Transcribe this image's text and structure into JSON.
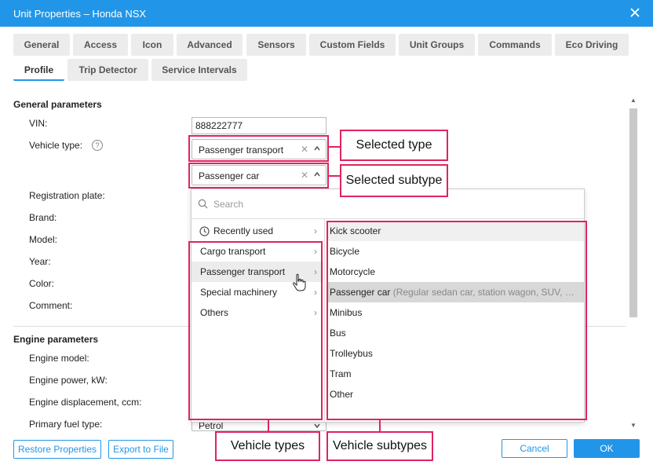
{
  "window": {
    "title": "Unit Properties – Honda NSX"
  },
  "tabs_row1": [
    "General",
    "Access",
    "Icon",
    "Advanced",
    "Sensors",
    "Custom Fields",
    "Unit Groups",
    "Commands",
    "Eco Driving"
  ],
  "tabs_row2": [
    "Profile",
    "Trip Detector",
    "Service Intervals"
  ],
  "active_tab": "Profile",
  "general": {
    "section_title": "General parameters",
    "vin_label": "VIN:",
    "vin_value": "888222777",
    "vehicle_type_label": "Vehicle type:",
    "vehicle_type_value": "Passenger transport",
    "vehicle_subtype_value": "Passenger car",
    "registration_label": "Registration plate:",
    "brand_label": "Brand:",
    "model_label": "Model:",
    "year_label": "Year:",
    "color_label": "Color:",
    "comment_label": "Comment:"
  },
  "engine": {
    "section_title": "Engine parameters",
    "model_label": "Engine model:",
    "power_label": "Engine power, kW:",
    "displacement_label": "Engine displacement, ccm:",
    "fuel_label": "Primary fuel type:",
    "fuel_value": "Petrol"
  },
  "dropdown": {
    "search_placeholder": "Search",
    "recently_used": "Recently used",
    "types": [
      "Cargo transport",
      "Passenger transport",
      "Special machinery",
      "Others"
    ],
    "hovered_type": "Passenger transport",
    "subtypes": [
      {
        "name": "Kick scooter",
        "desc": ""
      },
      {
        "name": "Bicycle",
        "desc": ""
      },
      {
        "name": "Motorcycle",
        "desc": ""
      },
      {
        "name": "Passenger car",
        "desc": "(Regular sedan car, station wagon, SUV, …"
      },
      {
        "name": "Minibus",
        "desc": ""
      },
      {
        "name": "Bus",
        "desc": ""
      },
      {
        "name": "Trolleybus",
        "desc": ""
      },
      {
        "name": "Tram",
        "desc": ""
      },
      {
        "name": "Other",
        "desc": ""
      }
    ],
    "selected_subtype": "Passenger car"
  },
  "annotations": {
    "selected_type": "Selected type",
    "selected_subtype": "Selected subtype",
    "vehicle_types": "Vehicle types",
    "vehicle_subtypes": "Vehicle subtypes"
  },
  "footer": {
    "restore": "Restore Properties",
    "export": "Export to File",
    "cancel": "Cancel",
    "ok": "OK"
  },
  "colors": {
    "accent": "#2196e8",
    "annotation": "#e0245e"
  }
}
